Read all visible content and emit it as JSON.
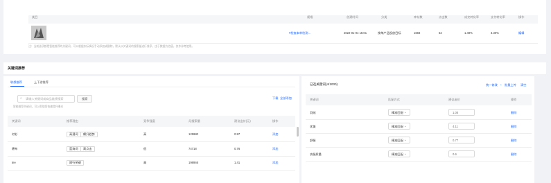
{
  "top": {
    "headers": [
      "类目",
      "规格",
      "创建时间",
      "分类",
      "库存数",
      "点击数",
      "成交转化率",
      "支付转化率",
      "操作"
    ],
    "row": {
      "link": "#检查本单检测…",
      "time": "2022-01-04 15:01",
      "category": "按单产品投放目标",
      "n1": "1684",
      "n2": "52",
      "p1": "1.49%",
      "p2": "3.30%",
      "action": "编辑"
    },
    "note": "注：当前选项都是智能推荐的关键词，可以根据实际情况手动添加或删除，默认以关键词的搜索量进行排序，由于数据为估值，仅作参考使用。"
  },
  "section_title": "关键词推荐",
  "left": {
    "tabs": [
      "联想推荐",
      "上下游推荐"
    ],
    "search_placeholder": "请输入关键词或商品链接搜索",
    "search_button": "搜索",
    "link_download": "下载",
    "link_all": "全部添加",
    "hint": "智能推荐关键词，可以帮助您快速提升曝光",
    "headers": [
      "关键词",
      "推荐理由",
      "竞争强度",
      "月搜索量",
      "建议出价(元)",
      "操作"
    ],
    "rows": [
      {
        "keyword": "衬衫",
        "tags": [
          "高潜词",
          "飙升趋势"
        ],
        "comp": "高",
        "volume": "125980",
        "bid": "0.97",
        "action": "添加"
      },
      {
        "keyword": "棉布",
        "tags": [
          "蓝海词",
          "高点击"
        ],
        "comp": "低",
        "volume": "74718",
        "bid": "0.76",
        "action": "添加"
      },
      {
        "keyword": "tee",
        "tags": [
          "周行关键"
        ],
        "comp": "高",
        "volume": "198946",
        "bid": "1.41",
        "action": "添加"
      }
    ]
  },
  "right": {
    "title": "已选关键词(4/1000)",
    "links": [
      "统一修改",
      "批量上传",
      "清空"
    ],
    "headers": [
      "关键词",
      "匹配方式",
      "建议出价",
      "操作"
    ],
    "rows": [
      {
        "keyword": "羽绒",
        "match": "精准匹配",
        "bid": "1.00",
        "action": "删除"
      },
      {
        "keyword": "优美",
        "match": "精准匹配",
        "bid": "4.11",
        "action": "删除"
      },
      {
        "keyword": "舒服",
        "match": "精准匹配",
        "bid": "0.77",
        "action": "删除"
      },
      {
        "keyword": "衣服质量",
        "match": "精准匹配",
        "bid": "0.6",
        "action": "删除"
      }
    ]
  },
  "colors": {
    "accent": "#1a66ff",
    "header_bg": "#f5f6f8"
  }
}
